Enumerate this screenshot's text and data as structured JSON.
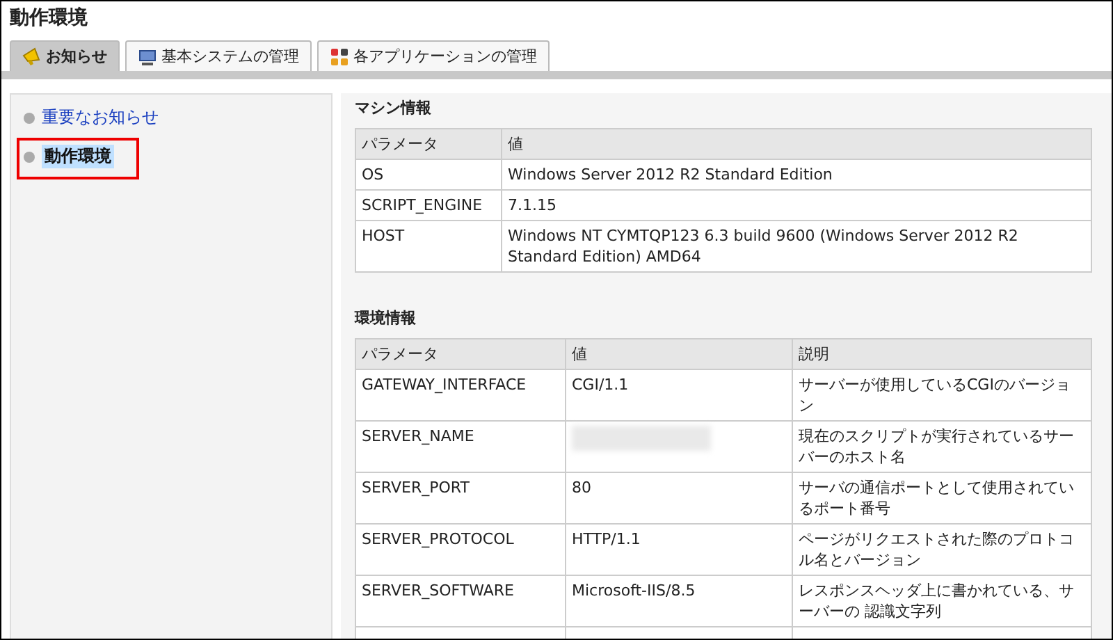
{
  "page": {
    "title": "動作環境"
  },
  "tabs": [
    {
      "label": "お知らせ",
      "selected": true
    },
    {
      "label": "基本システムの管理",
      "selected": false
    },
    {
      "label": "各アプリケーションの管理",
      "selected": false
    }
  ],
  "sidebar": {
    "items": [
      {
        "label": "重要なお知らせ",
        "selected": false,
        "annotated": false
      },
      {
        "label": "動作環境",
        "selected": true,
        "annotated": true
      }
    ]
  },
  "machine_info": {
    "heading": "マシン情報",
    "columns": [
      "パラメータ",
      "値"
    ],
    "rows": [
      {
        "parameter": "OS",
        "value": "Windows Server 2012 R2 Standard Edition"
      },
      {
        "parameter": "SCRIPT_ENGINE",
        "value": "7.1.15"
      },
      {
        "parameter": "HOST",
        "value": "Windows NT CYMTQP123 6.3 build 9600 (Windows Server 2012 R2 Standard Edition) AMD64"
      }
    ]
  },
  "environment_info": {
    "heading": "環境情報",
    "columns": [
      "パラメータ",
      "値",
      "説明"
    ],
    "rows": [
      {
        "parameter": "GATEWAY_INTERFACE",
        "value": "CGI/1.1",
        "description": "サーバーが使用しているCGIのバージョン"
      },
      {
        "parameter": "SERVER_NAME",
        "value_blurred": true,
        "description": "現在のスクリプトが実行されているサーバーのホスト名"
      },
      {
        "parameter": "SERVER_PORT",
        "value": "80",
        "description": "サーバの通信ポートとして使用されているポート番号"
      },
      {
        "parameter": "SERVER_PROTOCOL",
        "value": "HTTP/1.1",
        "description": "ページがリクエストされた際のプロトコル名とバージョン"
      },
      {
        "parameter": "SERVER_SOFTWARE",
        "value": "Microsoft-IIS/8.5",
        "description": "レスポンスヘッダ上に書かれている、サーバーの 認識文字列"
      }
    ]
  }
}
